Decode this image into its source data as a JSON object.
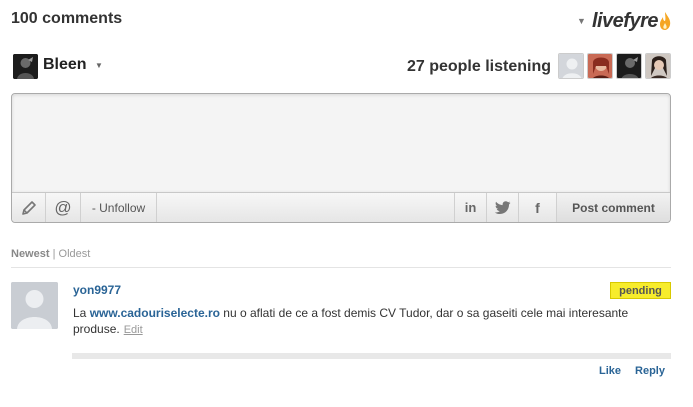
{
  "header": {
    "comment_count": "100 comments",
    "brand_logo": "livefyre"
  },
  "user": {
    "name": "Bleen"
  },
  "listening": {
    "text": "27 people listening"
  },
  "toolbar": {
    "pencil_icon": "pencil-icon",
    "at_icon": "@",
    "unfollow_label": "- Unfollow",
    "linkedin_label": "in",
    "twitter_icon": "twitter-icon",
    "facebook_label": "f",
    "post_label": "Post comment"
  },
  "sort": {
    "newest": "Newest",
    "separator": "|",
    "oldest": "Oldest"
  },
  "comments": [
    {
      "author": "yon9977",
      "status": "pending",
      "text_before": "La ",
      "site": "www.cadouriselecte.ro",
      "text_after": " nu o aflati de ce a fost demis CV Tudor, dar o sa gaseiti cele mai interesante  produse.",
      "edit_label": "Edit",
      "like_label": "Like",
      "reply_label": "Reply"
    }
  ],
  "colors": {
    "link": "#2a6496",
    "pending_badge": "#f7ec2c",
    "flame": "#f5a623"
  }
}
